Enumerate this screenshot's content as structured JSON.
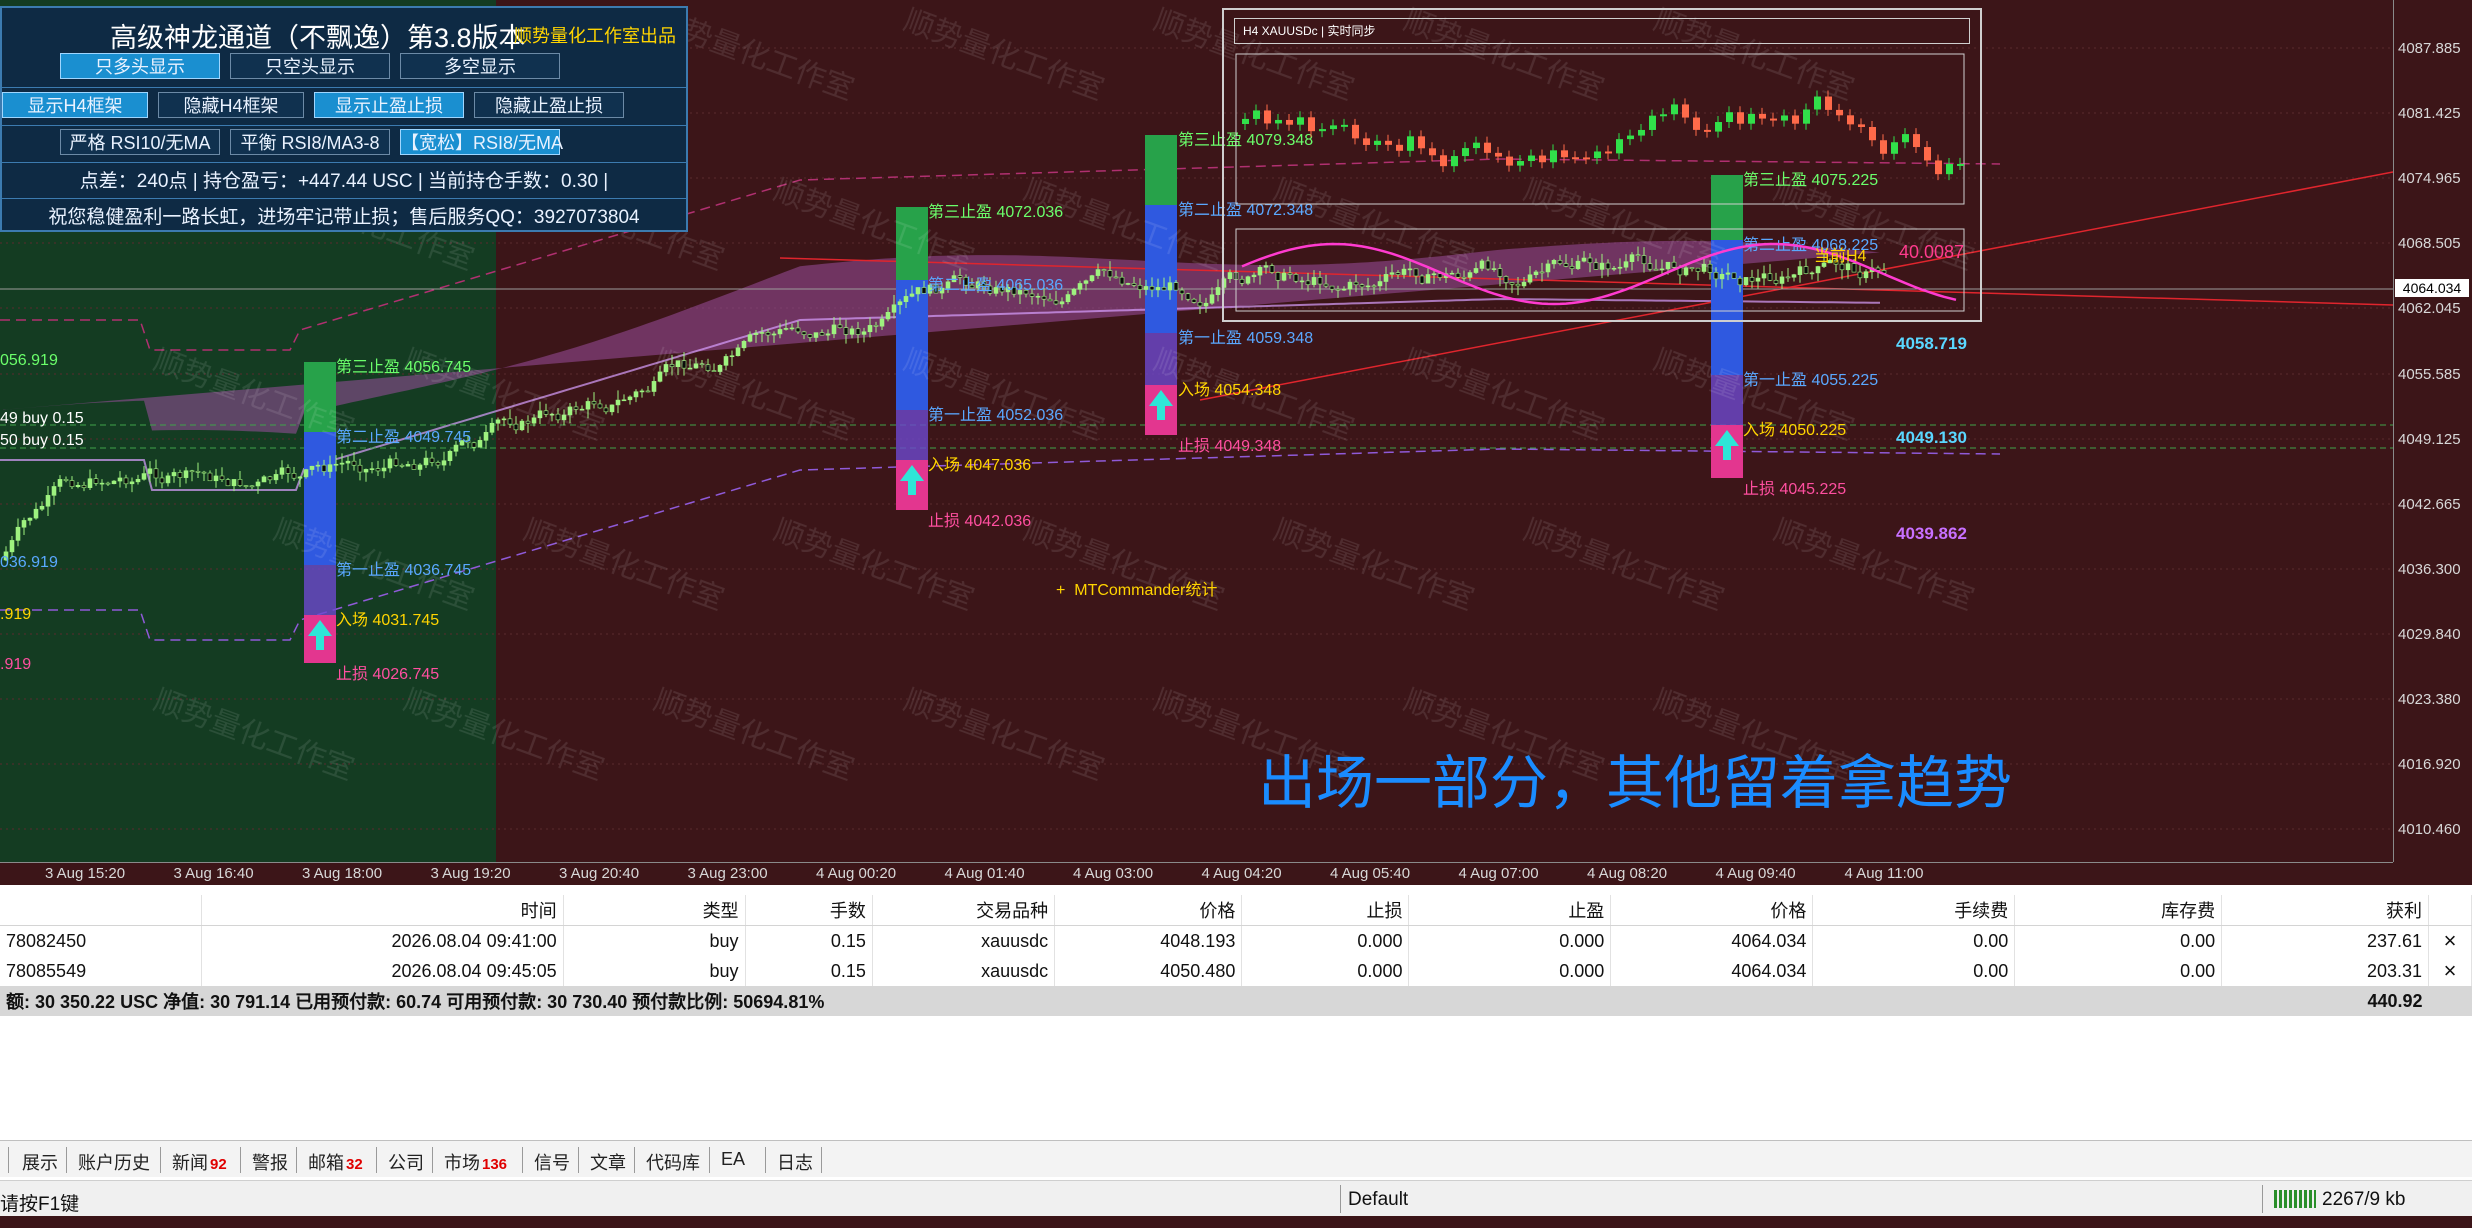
{
  "panel": {
    "title": "高级神龙通道（不飘逸）第3.8版本",
    "subtitle": "顺势量化工作室出品",
    "row1": [
      "只多头显示",
      "只空头显示",
      "多空显示"
    ],
    "row2": [
      "显示H4框架",
      "隐藏H4框架",
      "显示止盈止损",
      "隐藏止盈止损"
    ],
    "row3": [
      "严格 RSI10/无MA",
      "平衡 RSI8/MA3-8",
      "【宽松】RSI8/无MA"
    ],
    "info": "点差：240点 | 持仓盈亏：+447.44 USC | 当前持仓手数：0.30 |",
    "wish": "祝您稳健盈利一路长虹，进场牢记带止损；售后服务QQ：3927073804"
  },
  "price_axis": [
    "4087.885",
    "4081.425",
    "4074.965",
    "4068.505",
    "4062.045",
    "4055.585",
    "4049.125",
    "4042.665",
    "4036.300",
    "4029.840",
    "4023.380",
    "4016.920",
    "4010.460"
  ],
  "current_price": "4064.034",
  "time_axis": [
    "3 Aug 15:20",
    "3 Aug 16:40",
    "3 Aug 18:00",
    "3 Aug 19:20",
    "3 Aug 20:40",
    "3 Aug 23:00",
    "4 Aug 00:20",
    "4 Aug 01:40",
    "4 Aug 03:00",
    "4 Aug 04:20",
    "4 Aug 05:40",
    "4 Aug 07:00",
    "4 Aug 08:20",
    "4 Aug 09:40",
    "4 Aug 11:00"
  ],
  "levels": {
    "left_edge": [
      "056.919",
      "036.919",
      ".919",
      ".919"
    ],
    "buy_lines": [
      "49 buy 0.15",
      "50 buy 0.15"
    ],
    "group1": {
      "tp3": "第三止盈  4056.745",
      "tp2": "第二止盈  4049.745",
      "tp1": "第一止盈  4036.745",
      "entry": "入场  4031.745",
      "sl": "止损  4026.745"
    },
    "group2": {
      "tp3": "第三止盈  4072.036",
      "tp2": "第二止盈  4065.036",
      "tp1": "第一止盈  4052.036",
      "entry": "入场  4047.036",
      "sl": "止损  4042.036"
    },
    "group3": {
      "tp3": "第三止盈  4079.348",
      "tp2": "第二止盈  4072.348",
      "tp1": "第一止盈  4059.348",
      "entry": "入场  4054.348",
      "sl": "止损  4049.348"
    },
    "group4": {
      "tp3": "第三止盈  4075.225",
      "tp2": "第二止盈  4068.225",
      "tp1": "第一止盈  4055.225",
      "entry": "入场  4050.225",
      "sl": "止损  4045.225"
    },
    "right": [
      "4058.719",
      "4049.130",
      "4039.862"
    ]
  },
  "mini_chart": {
    "header": "H4  XAUUSDc  |  实时同步",
    "tag1": "当前H4",
    "tag2": "40.0087"
  },
  "mtc_label": "MTCommander统计",
  "big_note": "出场一部分，其他留着拿趋势",
  "watermark": "顺势量化工作室",
  "table": {
    "headers": [
      "",
      "时间",
      "类型",
      "手数",
      "交易品种",
      "价格",
      "止损",
      "止盈",
      "价格",
      "手续费",
      "库存费",
      "获利",
      ""
    ],
    "rows": [
      [
        "78082450",
        "2026.08.04 09:41:00",
        "buy",
        "0.15",
        "xauusdc",
        "4048.193",
        "0.000",
        "0.000",
        "4064.034",
        "0.00",
        "0.00",
        "237.61",
        "×"
      ],
      [
        "78085549",
        "2026.08.04 09:45:05",
        "buy",
        "0.15",
        "xauusdc",
        "4050.480",
        "0.000",
        "0.000",
        "4064.034",
        "0.00",
        "0.00",
        "203.31",
        "×"
      ]
    ],
    "summary": "额: 30 350.22 USC  净值: 30 791.14  已用预付款: 60.74  可用预付款: 30 730.40  预付款比例: 50694.81%",
    "summary_profit": "440.92"
  },
  "tabs": [
    {
      "label": "展示",
      "badge": ""
    },
    {
      "label": "账户历史",
      "badge": ""
    },
    {
      "label": "新闻",
      "badge": "92"
    },
    {
      "label": "警报",
      "badge": ""
    },
    {
      "label": "邮箱",
      "badge": "32"
    },
    {
      "label": "公司",
      "badge": ""
    },
    {
      "label": "市场",
      "badge": "136"
    },
    {
      "label": "信号",
      "badge": ""
    },
    {
      "label": "文章",
      "badge": ""
    },
    {
      "label": "代码库",
      "badge": ""
    },
    {
      "label": "EA",
      "badge": ""
    },
    {
      "label": "日志",
      "badge": ""
    }
  ],
  "status": {
    "help": "请按F1键",
    "profile": "Default",
    "traffic": "2267/9 kb"
  },
  "colors": {
    "chart_bg": "#3c1518",
    "green_zone": "#143c22",
    "accent_blue": "#1a8cff"
  }
}
